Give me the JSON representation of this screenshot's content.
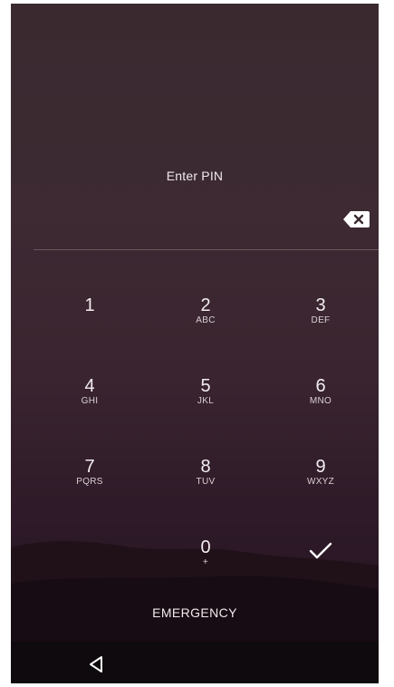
{
  "lockscreen": {
    "prompt": "Enter PIN",
    "emergency_label": "EMERGENCY"
  },
  "keypad": [
    {
      "digit": "1",
      "letters": ""
    },
    {
      "digit": "2",
      "letters": "ABC"
    },
    {
      "digit": "3",
      "letters": "DEF"
    },
    {
      "digit": "4",
      "letters": "GHI"
    },
    {
      "digit": "5",
      "letters": "JKL"
    },
    {
      "digit": "6",
      "letters": "MNO"
    },
    {
      "digit": "7",
      "letters": "PQRS"
    },
    {
      "digit": "8",
      "letters": "TUV"
    },
    {
      "digit": "9",
      "letters": "WXYZ"
    },
    {
      "digit": "0",
      "letters": "+"
    }
  ],
  "icons": {
    "backspace": "backspace-icon",
    "enter": "checkmark-icon",
    "back": "back-triangle-icon"
  }
}
